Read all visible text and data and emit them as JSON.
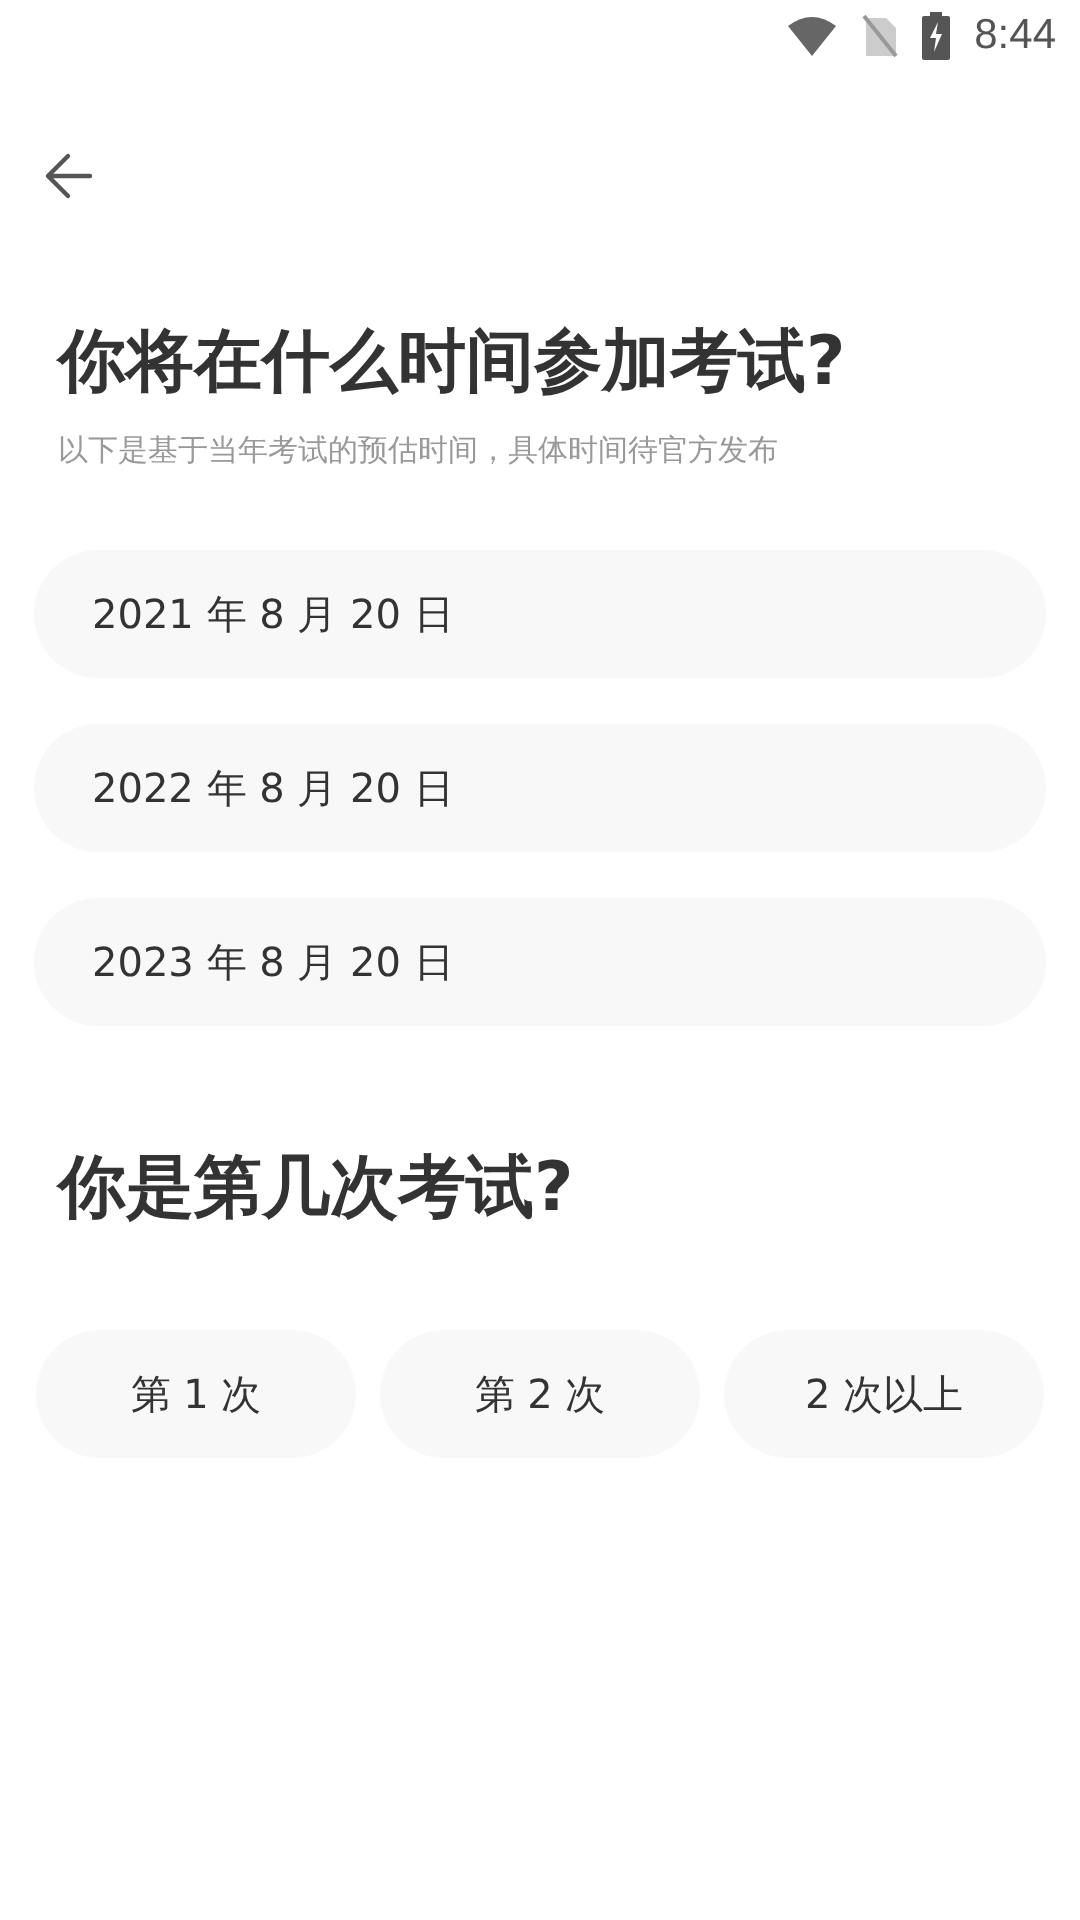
{
  "status_bar": {
    "time": "8:44"
  },
  "question_date": {
    "title": "你将在什么时间参加考试?",
    "subtitle": "以下是基于当年考试的预估时间，具体时间待官方发布",
    "options": [
      {
        "label": "2021 年 8 月 20 日",
        "selected": false
      },
      {
        "label": "2022 年 8 月 20 日",
        "selected": false
      },
      {
        "label": "2023 年 8 月 20 日",
        "selected": false
      }
    ]
  },
  "question_count": {
    "title": "你是第几次考试?",
    "options": [
      {
        "label": "第 1 次",
        "selected": false
      },
      {
        "label": "第 2 次",
        "selected": false
      },
      {
        "label": "2 次以上",
        "selected": false
      }
    ]
  }
}
